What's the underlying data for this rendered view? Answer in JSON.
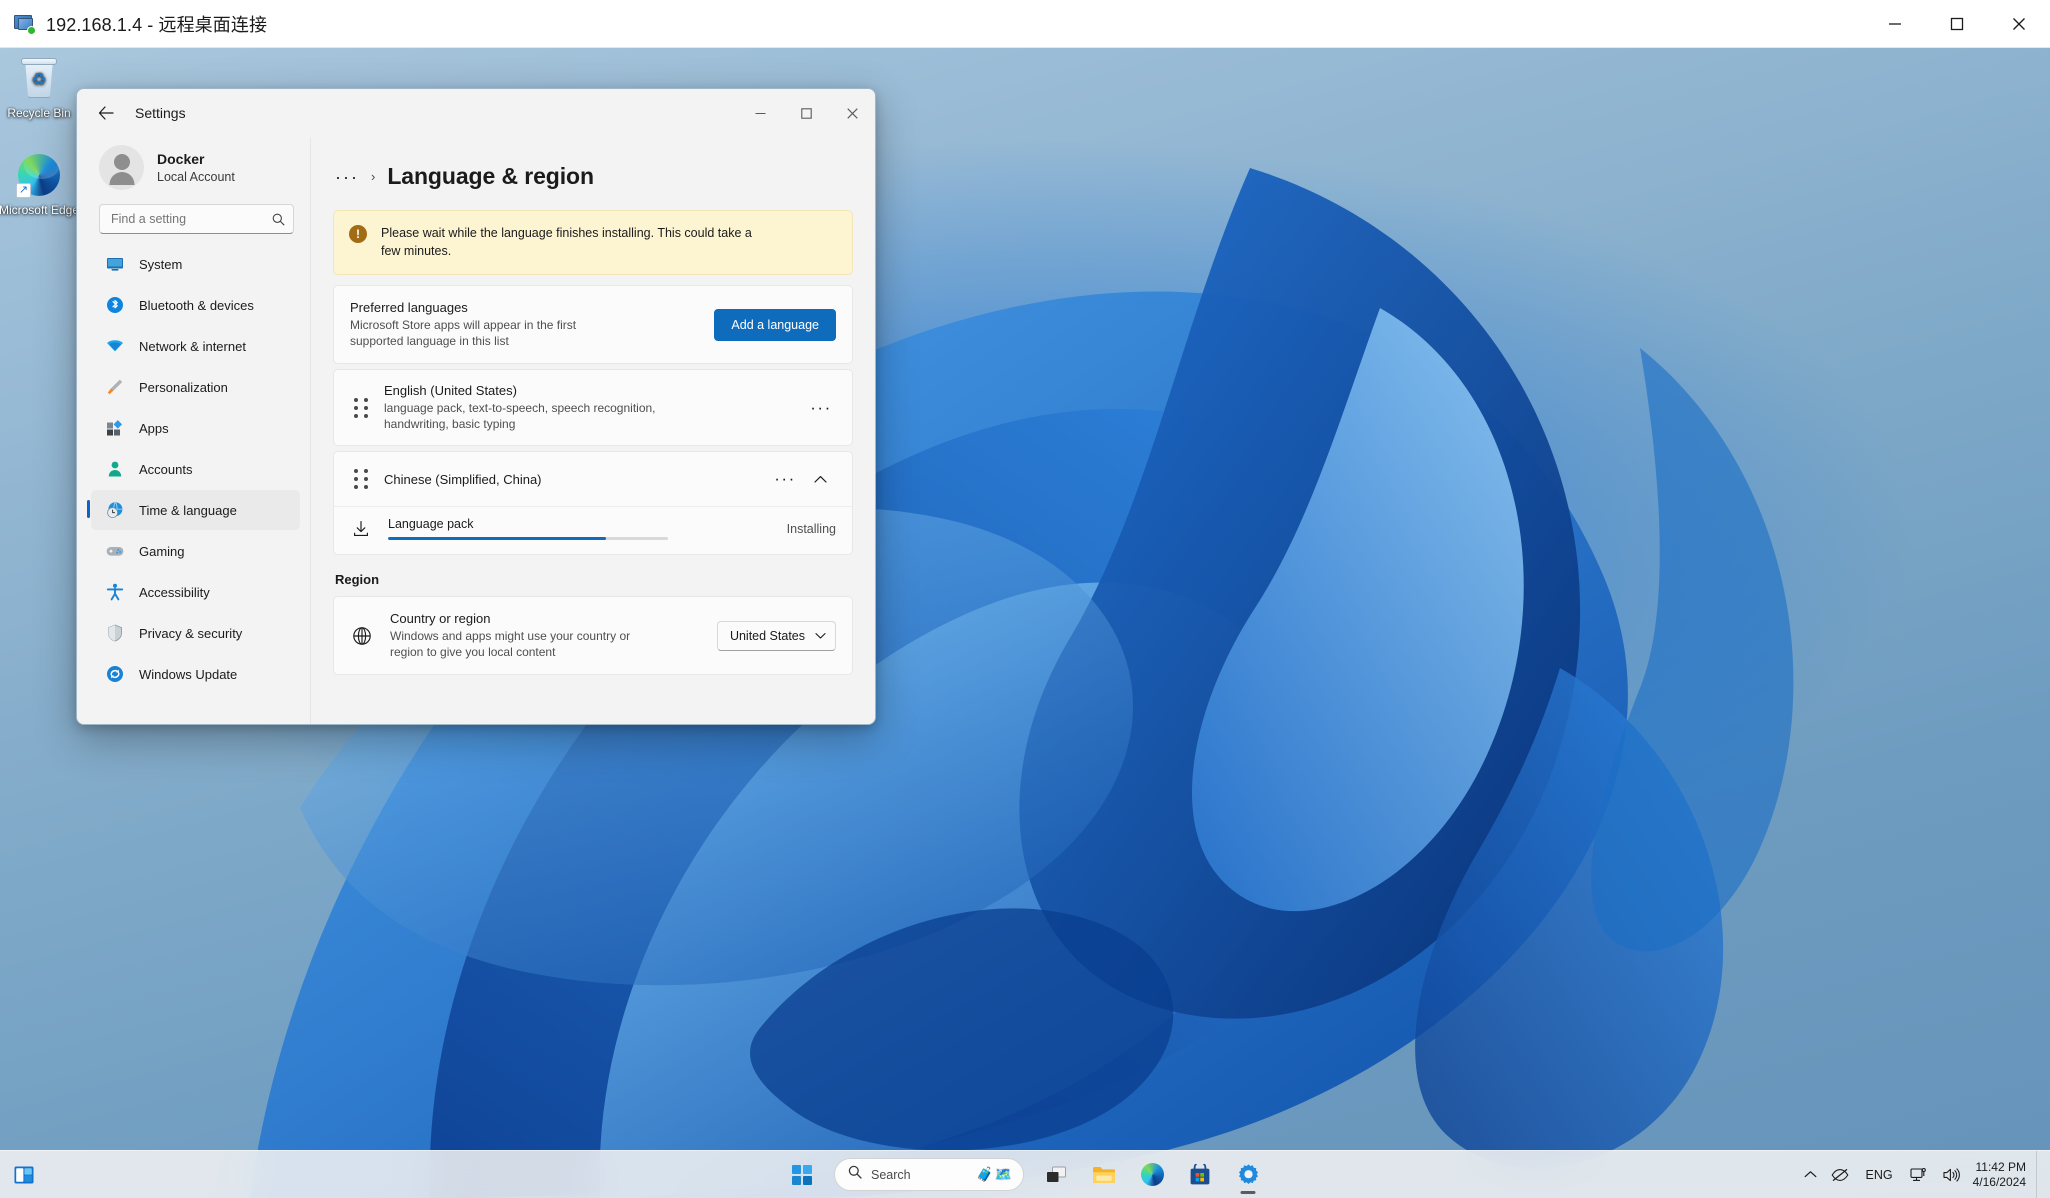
{
  "rdp_window": {
    "title": "192.168.1.4 - 远程桌面连接",
    "icon": "remote-desktop-icon",
    "controls": {
      "minimize": "minimize-icon",
      "maximize": "maximize-icon",
      "close": "close-icon"
    }
  },
  "desktop": {
    "icons": [
      {
        "name": "Recycle Bin",
        "icon": "recycle-bin-icon"
      },
      {
        "name": "Microsoft Edge",
        "icon": "edge-icon"
      }
    ]
  },
  "settings": {
    "app_title": "Settings",
    "back_icon": "back-arrow-icon",
    "controls": {
      "minimize": "minimize-icon",
      "maximize": "maximize-icon",
      "close": "close-icon"
    },
    "account": {
      "name": "Docker",
      "type": "Local Account",
      "avatar": "user-avatar-icon"
    },
    "search": {
      "placeholder": "Find a setting",
      "value": "",
      "icon": "search-icon"
    },
    "nav": [
      {
        "label": "System",
        "icon": "system-monitor-icon",
        "selected": false
      },
      {
        "label": "Bluetooth & devices",
        "icon": "bluetooth-icon",
        "selected": false
      },
      {
        "label": "Network & internet",
        "icon": "wifi-icon",
        "selected": false
      },
      {
        "label": "Personalization",
        "icon": "paintbrush-icon",
        "selected": false
      },
      {
        "label": "Apps",
        "icon": "apps-grid-icon",
        "selected": false
      },
      {
        "label": "Accounts",
        "icon": "person-icon",
        "selected": false
      },
      {
        "label": "Time & language",
        "icon": "clock-globe-icon",
        "selected": true
      },
      {
        "label": "Gaming",
        "icon": "gamepad-icon",
        "selected": false
      },
      {
        "label": "Accessibility",
        "icon": "accessibility-person-icon",
        "selected": false
      },
      {
        "label": "Privacy & security",
        "icon": "shield-icon",
        "selected": false
      },
      {
        "label": "Windows Update",
        "icon": "update-refresh-icon",
        "selected": false
      }
    ],
    "breadcrumb": {
      "ellipsis": "···",
      "separator": "›",
      "title": "Language & region"
    },
    "warning": {
      "icon": "warning-exclamation-icon",
      "text": "Please wait while the language finishes installing. This could take a few minutes."
    },
    "preferred_languages": {
      "title": "Preferred languages",
      "description": "Microsoft Store apps will appear in the first supported language in this list",
      "add_button": "Add a language"
    },
    "languages": [
      {
        "name": "English (United States)",
        "features": "language pack, text-to-speech, speech recognition, handwriting, basic typing",
        "drag_handle": "drag-handle-icon",
        "more": "···",
        "expanded": false
      },
      {
        "name": "Chinese (Simplified, China)",
        "features": "",
        "drag_handle": "drag-handle-icon",
        "more": "···",
        "expanded": true,
        "sub_item": {
          "icon": "download-icon",
          "label": "Language pack",
          "status": "Installing",
          "progress_percent": 78
        }
      }
    ],
    "region": {
      "heading": "Region",
      "icon": "globe-icon",
      "title": "Country or region",
      "description": "Windows and apps might use your country or region to give you local content",
      "selected": "United States",
      "chevron": "chevron-down-icon"
    }
  },
  "taskbar": {
    "widgets_icon": "widgets-icon",
    "start_icon": "windows-start-icon",
    "search": {
      "placeholder": "Search",
      "icon": "search-icon",
      "emoji_1": "🧳",
      "emoji_2": "🗺️"
    },
    "apps": [
      {
        "name": "Task View",
        "icon": "task-view-icon",
        "active": false
      },
      {
        "name": "File Explorer",
        "icon": "file-explorer-icon",
        "active": false
      },
      {
        "name": "Microsoft Edge",
        "icon": "edge-icon",
        "active": false
      },
      {
        "name": "Microsoft Store",
        "icon": "store-icon",
        "active": false
      },
      {
        "name": "Settings",
        "icon": "settings-gear-icon",
        "active": true
      }
    ],
    "tray": {
      "chevron": "chevron-up-icon",
      "hidden_icon": "eye-off-icon",
      "language": "ENG",
      "network": "network-icon",
      "volume": "volume-icon",
      "time": "11:42 PM",
      "date": "4/16/2024"
    }
  },
  "colors": {
    "accent": "#0f6cbd",
    "warning_bg": "#fdf4d2",
    "warning_icon": "#a16c14",
    "selected_nav": "#eaeaea",
    "window_bg": "#f3f3f3"
  }
}
